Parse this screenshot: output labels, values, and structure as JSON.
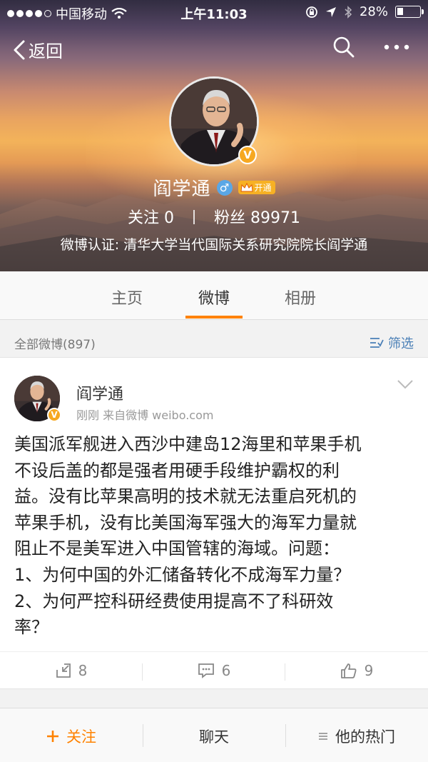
{
  "status_bar": {
    "carrier": "中国移动",
    "time": "上午11:03",
    "battery": "28%",
    "battery_level": 0.28
  },
  "nav": {
    "back_label": "返回"
  },
  "profile": {
    "name": "阎学通",
    "vip_label": "开通",
    "following_label": "关注",
    "following_count": "0",
    "followers_label": "粉丝",
    "followers_count": "89971",
    "verification": "微博认证: 清华大学当代国际关系研究院院长阎学通",
    "badge": "V"
  },
  "tabs": [
    {
      "label": "主页",
      "active": false
    },
    {
      "label": "微博",
      "active": true
    },
    {
      "label": "相册",
      "active": false
    }
  ],
  "feed_header": {
    "count_label": "全部微博(897)",
    "filter_label": "筛选"
  },
  "post": {
    "author": "阎学通",
    "meta": "刚刚  来自微博 weibo.com",
    "text": "美国派军舰进入西沙中建岛12海里和苹果手机不设后盖的都是强者用硬手段维护霸权的利益。没有比苹果高明的技术就无法重启死机的苹果手机，没有比美国海军强大的海军力量就阻止不是美军进入中国管辖的海域。问题：1、为何中国的外汇储备转化不成海军力量？2、为何严控科研经费使用提高不了科研效率？",
    "text_lines": [
      "美国派军舰进入西沙中建岛12海里和苹果手机",
      "不设后盖的都是强者用硬手段维护霸权的利",
      "益。没有比苹果高明的技术就无法重启死机的",
      "苹果手机，没有比美国海军强大的海军力量就",
      "阻止不是美军进入中国管辖的海域。问题：",
      "1、为何中国的外汇储备转化不成海军力量？",
      "2、为何严控科研经费使用提高不了科研效",
      "率？"
    ],
    "reposts": "8",
    "comments": "6",
    "likes": "9"
  },
  "bottom_bar": {
    "follow_label": "关注",
    "chat_label": "聊天",
    "hot_label": "他的热门"
  },
  "colors": {
    "accent": "#ff8200",
    "link": "#4a7fb6",
    "verified": "#f6a821"
  },
  "icons": [
    "wifi-icon",
    "lock-rotation-icon",
    "location-arrow-icon",
    "bluetooth-icon",
    "back-chevron-icon",
    "search-icon",
    "more-icon",
    "gender-male-icon",
    "crown-icon",
    "filter-icon",
    "chevron-down-icon",
    "repost-icon",
    "comment-icon",
    "like-icon",
    "plus-icon",
    "list-icon"
  ]
}
